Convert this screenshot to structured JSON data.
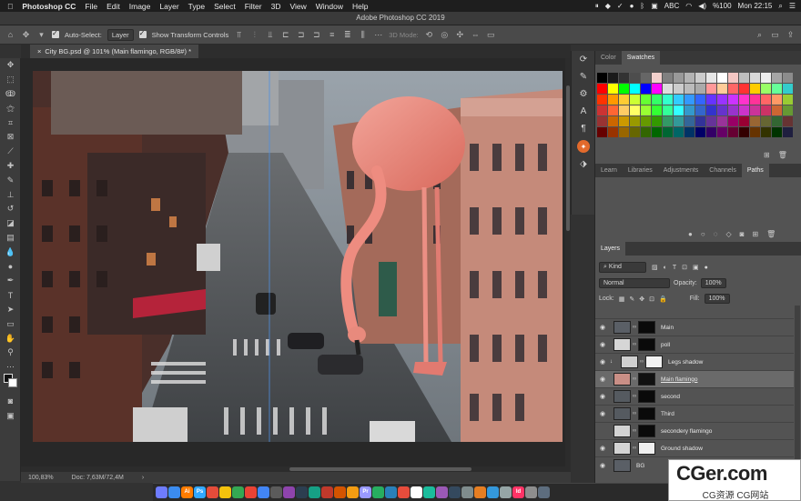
{
  "menubar": {
    "app": "Photoshop CC",
    "items": [
      "File",
      "Edit",
      "Image",
      "Layer",
      "Type",
      "Select",
      "Filter",
      "3D",
      "View",
      "Window",
      "Help"
    ],
    "status": {
      "input": "ABC",
      "battery": "%100",
      "clock": "Mon 22:15"
    }
  },
  "window": {
    "title": "Adobe Photoshop CC 2019"
  },
  "options": {
    "auto_select_label": "Auto-Select:",
    "auto_select_value": "Layer",
    "transform_label": "Show Transform Controls",
    "mode_3d": "3D Mode:"
  },
  "document": {
    "tab": "City BG.psd @ 101% (Main flamingo, RGB/8#) *",
    "zoom": "100,83%",
    "doc_size": "Doc: 7,63M/72,4M"
  },
  "panels": {
    "top_tabs": [
      "Color",
      "Swatches"
    ],
    "mid_tabs": [
      "Learn",
      "Libraries",
      "Adjustments",
      "Channels",
      "Paths"
    ],
    "layers_tab": "Layers",
    "kind": "Kind",
    "blend_mode": "Normal",
    "opacity_label": "Opacity:",
    "opacity_value": "100%",
    "lock_label": "Lock:",
    "fill_label": "Fill:",
    "fill_value": "100%"
  },
  "layers": [
    {
      "name": "Main",
      "visible": true,
      "selected": false,
      "thumb": "#5a5f66",
      "mask": "#0a0a0a",
      "indent": false
    },
    {
      "name": "poll",
      "visible": true,
      "selected": false,
      "thumb": "#d6d6d6",
      "mask": "#0a0a0a",
      "indent": false
    },
    {
      "name": "Legs shadow",
      "visible": true,
      "selected": false,
      "thumb": "#cfcfcf",
      "mask": "#f2f2f2",
      "indent": true
    },
    {
      "name": "Main flamingo",
      "visible": true,
      "selected": true,
      "thumb": "#c98f86",
      "mask": "#111111",
      "indent": false
    },
    {
      "name": "second",
      "visible": true,
      "selected": false,
      "thumb": "#555a60",
      "mask": "#0a0a0a",
      "indent": false
    },
    {
      "name": "Third",
      "visible": true,
      "selected": false,
      "thumb": "#555a60",
      "mask": "#0a0a0a",
      "indent": false
    },
    {
      "name": "secondery flamingo",
      "visible": false,
      "selected": false,
      "thumb": "#d3d3d3",
      "mask": "#0a0a0a",
      "indent": false
    },
    {
      "name": "Ground shadow",
      "visible": true,
      "selected": false,
      "thumb": "#d3d3d3",
      "mask": "#efefef",
      "indent": false
    },
    {
      "name": "BG",
      "visible": true,
      "selected": false,
      "thumb": "#5a5f66",
      "mask": "",
      "indent": false
    }
  ],
  "swatch_colors": [
    "#000000",
    "#1a1a1a",
    "#333333",
    "#4d4d4d",
    "#666666",
    "#f2d0cc",
    "#808080",
    "#999999",
    "#b3b3b3",
    "#cccccc",
    "#e6e6e6",
    "#ffffff",
    "#f4c7c3",
    "#bfbfbf",
    "#d9d9d9",
    "#eeeeee",
    "#a6a6a6",
    "#8c8c8c",
    "#ff0000",
    "#ffff00",
    "#00ff00",
    "#00ffff",
    "#0000ff",
    "#ff00ff",
    "#dddddd",
    "#cccccc",
    "#bbbbbb",
    "#aaaaaa",
    "#ff9999",
    "#ffcc99",
    "#ff6666",
    "#ff3333",
    "#ffcc00",
    "#99ff66",
    "#66ff99",
    "#33cccc",
    "#ff3300",
    "#ff9900",
    "#ffcc33",
    "#ccff33",
    "#66ff33",
    "#33ff66",
    "#33ffcc",
    "#33ccff",
    "#3399ff",
    "#3366ff",
    "#6633ff",
    "#9933ff",
    "#cc33ff",
    "#ff33cc",
    "#ff3399",
    "#ff6666",
    "#ff9966",
    "#99cc33",
    "#cc3333",
    "#ff6633",
    "#ffcc66",
    "#ffff66",
    "#99ff33",
    "#33ff33",
    "#33ff99",
    "#33ffff",
    "#3399cc",
    "#3366cc",
    "#3333cc",
    "#6633cc",
    "#9933cc",
    "#cc33cc",
    "#cc3399",
    "#cc3366",
    "#cc6633",
    "#669933",
    "#993333",
    "#cc6600",
    "#cc9900",
    "#999900",
    "#669900",
    "#339900",
    "#339966",
    "#339999",
    "#336699",
    "#333399",
    "#663399",
    "#993399",
    "#990066",
    "#990033",
    "#996633",
    "#666633",
    "#336633",
    "#663333",
    "#660000",
    "#993300",
    "#996600",
    "#666600",
    "#336600",
    "#006600",
    "#006633",
    "#006666",
    "#003366",
    "#000066",
    "#330066",
    "#660066",
    "#660033",
    "#330000",
    "#663300",
    "#333300",
    "#003300",
    "#1f1f3f"
  ],
  "dock_apps": [
    {
      "label": "",
      "color": "#6e7cff"
    },
    {
      "label": "",
      "color": "#3b8cf0"
    },
    {
      "label": "Ai",
      "color": "#ff7c00"
    },
    {
      "label": "Ps",
      "color": "#31a8ff"
    },
    {
      "label": "",
      "color": "#e44c3a"
    },
    {
      "label": "",
      "color": "#f4c20d"
    },
    {
      "label": "",
      "color": "#34a853"
    },
    {
      "label": "",
      "color": "#ea4335"
    },
    {
      "label": "",
      "color": "#4285f4"
    },
    {
      "label": "",
      "color": "#5b5b5b"
    },
    {
      "label": "",
      "color": "#8e44ad"
    },
    {
      "label": "",
      "color": "#2c3e50"
    },
    {
      "label": "",
      "color": "#16a085"
    },
    {
      "label": "",
      "color": "#c0392b"
    },
    {
      "label": "",
      "color": "#d35400"
    },
    {
      "label": "",
      "color": "#f39c12"
    },
    {
      "label": "Pr",
      "color": "#9999ff"
    },
    {
      "label": "",
      "color": "#27ae60"
    },
    {
      "label": "",
      "color": "#2980b9"
    },
    {
      "label": "",
      "color": "#e74c3c"
    },
    {
      "label": "",
      "color": "#ffffff"
    },
    {
      "label": "",
      "color": "#1abc9c"
    },
    {
      "label": "",
      "color": "#9b59b6"
    },
    {
      "label": "",
      "color": "#34495e"
    },
    {
      "label": "",
      "color": "#7f8c8d"
    },
    {
      "label": "",
      "color": "#e67e22"
    },
    {
      "label": "",
      "color": "#3498db"
    },
    {
      "label": "",
      "color": "#95a5a6"
    },
    {
      "label": "Id",
      "color": "#ff3366"
    },
    {
      "label": "",
      "color": "#8e8e8e"
    },
    {
      "label": "",
      "color": "#5d6d7e"
    }
  ],
  "watermark": {
    "big": "CGer.com",
    "small": "CG资源 CG网站"
  }
}
